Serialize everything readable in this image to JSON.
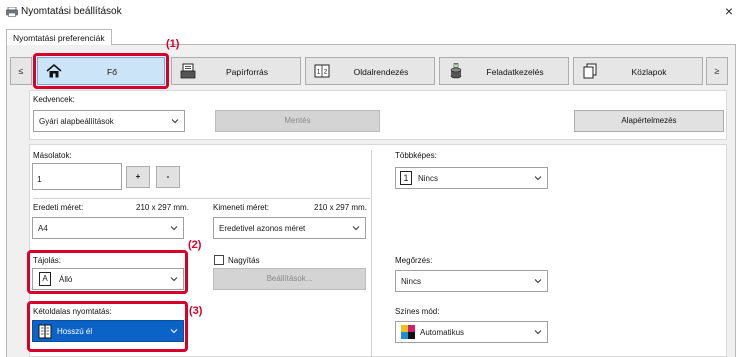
{
  "window": {
    "title": "Nyomtatási beállítások",
    "close_glyph": "×"
  },
  "tab": {
    "label": "Nyomtatási preferenciák"
  },
  "nav": {
    "prev_glyph": "≤",
    "next_glyph": "≥",
    "buttons": [
      {
        "label": "Fő",
        "icon": "home-icon"
      },
      {
        "label": "Papírforrás",
        "icon": "paper-tray-icon"
      },
      {
        "label": "Oldalrendezés",
        "icon": "page-layout-icon"
      },
      {
        "label": "Feladatkezelés",
        "icon": "job-handling-icon"
      },
      {
        "label": "Közlapok",
        "icon": "insert-pages-icon"
      }
    ]
  },
  "favorites": {
    "label": "Kedvencek:",
    "value": "Gyári alapbeállítások",
    "save_label": "Mentés",
    "defaults_label": "Alapértelmezés"
  },
  "copies": {
    "label": "Másolatok:",
    "value": "1",
    "plus": "+",
    "minus": "-"
  },
  "original_size": {
    "label": "Eredeti méret:",
    "dims": "210 x 297 mm.",
    "value": "A4"
  },
  "output_size": {
    "label": "Kimeneti méret:",
    "dims": "210 x 297 mm.",
    "value": "Eredetivel azonos méret"
  },
  "n_up": {
    "label": "Többképes:",
    "value": "Nincs",
    "icon_text": "1"
  },
  "orientation": {
    "label": "Tájolás:",
    "value": "Álló",
    "icon_text": "A"
  },
  "zoom": {
    "label": "Nagyítás",
    "settings_label": "Beállítások..."
  },
  "retention": {
    "label": "Megőrzés:",
    "value": "Nincs"
  },
  "duplex": {
    "label": "Kétoldalas nyomtatás:",
    "value": "Hosszú él"
  },
  "color_mode": {
    "label": "Színes mód:",
    "value": "Automatikus"
  },
  "callouts": [
    "(1)",
    "(2)",
    "(3)"
  ],
  "colors": {
    "highlight": "#d6002a",
    "active_tab": "#cce4f7",
    "selected": "#0c63c7"
  }
}
